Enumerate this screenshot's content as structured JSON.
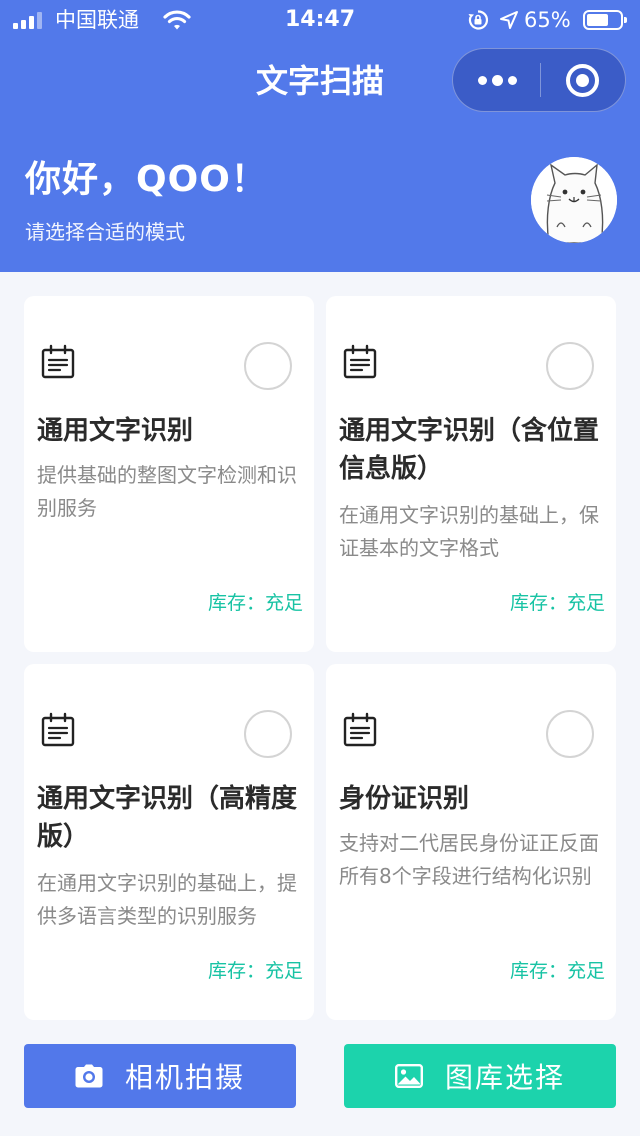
{
  "status_bar": {
    "carrier": "中国联通",
    "time": "14:47",
    "battery_percent": "65%",
    "battery_level": 0.65
  },
  "nav": {
    "title": "文字扫描"
  },
  "header": {
    "greeting": "你好，QOO！",
    "subtitle": "请选择合适的模式"
  },
  "cards": [
    {
      "title": "通用文字识别",
      "description": "提供基础的整图文字检测和识别服务",
      "stock": "库存：充足"
    },
    {
      "title": "通用文字识别（含位置信息版）",
      "description": "在通用文字识别的基础上，保证基本的文字格式",
      "stock": "库存：充足"
    },
    {
      "title": "通用文字识别（高精度版）",
      "description": "在通用文字识别的基础上，提供多语言类型的识别服务",
      "stock": "库存：充足"
    },
    {
      "title": "身份证识别",
      "description": "支持对二代居民身份证正反面所有8个字段进行结构化识别",
      "stock": "库存：充足"
    }
  ],
  "buttons": {
    "camera": "相机拍摄",
    "gallery": "图库选择"
  },
  "colors": {
    "primary": "#5279ea",
    "accent": "#1cd3ac",
    "stock_text": "#18c3a4"
  },
  "icons": {
    "card_icon": "document-icon",
    "camera_button_icon": "camera-icon",
    "gallery_button_icon": "image-icon"
  }
}
